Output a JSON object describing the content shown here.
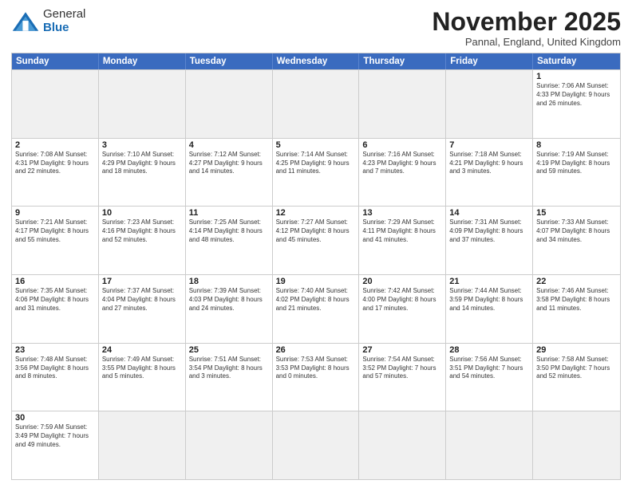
{
  "header": {
    "logo_general": "General",
    "logo_blue": "Blue",
    "title": "November 2025",
    "subtitle": "Pannal, England, United Kingdom"
  },
  "days_of_week": [
    "Sunday",
    "Monday",
    "Tuesday",
    "Wednesday",
    "Thursday",
    "Friday",
    "Saturday"
  ],
  "weeks": [
    [
      {
        "day": "",
        "info": ""
      },
      {
        "day": "",
        "info": ""
      },
      {
        "day": "",
        "info": ""
      },
      {
        "day": "",
        "info": ""
      },
      {
        "day": "",
        "info": ""
      },
      {
        "day": "",
        "info": ""
      },
      {
        "day": "1",
        "info": "Sunrise: 7:06 AM\nSunset: 4:33 PM\nDaylight: 9 hours\nand 26 minutes."
      }
    ],
    [
      {
        "day": "2",
        "info": "Sunrise: 7:08 AM\nSunset: 4:31 PM\nDaylight: 9 hours\nand 22 minutes."
      },
      {
        "day": "3",
        "info": "Sunrise: 7:10 AM\nSunset: 4:29 PM\nDaylight: 9 hours\nand 18 minutes."
      },
      {
        "day": "4",
        "info": "Sunrise: 7:12 AM\nSunset: 4:27 PM\nDaylight: 9 hours\nand 14 minutes."
      },
      {
        "day": "5",
        "info": "Sunrise: 7:14 AM\nSunset: 4:25 PM\nDaylight: 9 hours\nand 11 minutes."
      },
      {
        "day": "6",
        "info": "Sunrise: 7:16 AM\nSunset: 4:23 PM\nDaylight: 9 hours\nand 7 minutes."
      },
      {
        "day": "7",
        "info": "Sunrise: 7:18 AM\nSunset: 4:21 PM\nDaylight: 9 hours\nand 3 minutes."
      },
      {
        "day": "8",
        "info": "Sunrise: 7:19 AM\nSunset: 4:19 PM\nDaylight: 8 hours\nand 59 minutes."
      }
    ],
    [
      {
        "day": "9",
        "info": "Sunrise: 7:21 AM\nSunset: 4:17 PM\nDaylight: 8 hours\nand 55 minutes."
      },
      {
        "day": "10",
        "info": "Sunrise: 7:23 AM\nSunset: 4:16 PM\nDaylight: 8 hours\nand 52 minutes."
      },
      {
        "day": "11",
        "info": "Sunrise: 7:25 AM\nSunset: 4:14 PM\nDaylight: 8 hours\nand 48 minutes."
      },
      {
        "day": "12",
        "info": "Sunrise: 7:27 AM\nSunset: 4:12 PM\nDaylight: 8 hours\nand 45 minutes."
      },
      {
        "day": "13",
        "info": "Sunrise: 7:29 AM\nSunset: 4:11 PM\nDaylight: 8 hours\nand 41 minutes."
      },
      {
        "day": "14",
        "info": "Sunrise: 7:31 AM\nSunset: 4:09 PM\nDaylight: 8 hours\nand 37 minutes."
      },
      {
        "day": "15",
        "info": "Sunrise: 7:33 AM\nSunset: 4:07 PM\nDaylight: 8 hours\nand 34 minutes."
      }
    ],
    [
      {
        "day": "16",
        "info": "Sunrise: 7:35 AM\nSunset: 4:06 PM\nDaylight: 8 hours\nand 31 minutes."
      },
      {
        "day": "17",
        "info": "Sunrise: 7:37 AM\nSunset: 4:04 PM\nDaylight: 8 hours\nand 27 minutes."
      },
      {
        "day": "18",
        "info": "Sunrise: 7:39 AM\nSunset: 4:03 PM\nDaylight: 8 hours\nand 24 minutes."
      },
      {
        "day": "19",
        "info": "Sunrise: 7:40 AM\nSunset: 4:02 PM\nDaylight: 8 hours\nand 21 minutes."
      },
      {
        "day": "20",
        "info": "Sunrise: 7:42 AM\nSunset: 4:00 PM\nDaylight: 8 hours\nand 17 minutes."
      },
      {
        "day": "21",
        "info": "Sunrise: 7:44 AM\nSunset: 3:59 PM\nDaylight: 8 hours\nand 14 minutes."
      },
      {
        "day": "22",
        "info": "Sunrise: 7:46 AM\nSunset: 3:58 PM\nDaylight: 8 hours\nand 11 minutes."
      }
    ],
    [
      {
        "day": "23",
        "info": "Sunrise: 7:48 AM\nSunset: 3:56 PM\nDaylight: 8 hours\nand 8 minutes."
      },
      {
        "day": "24",
        "info": "Sunrise: 7:49 AM\nSunset: 3:55 PM\nDaylight: 8 hours\nand 5 minutes."
      },
      {
        "day": "25",
        "info": "Sunrise: 7:51 AM\nSunset: 3:54 PM\nDaylight: 8 hours\nand 3 minutes."
      },
      {
        "day": "26",
        "info": "Sunrise: 7:53 AM\nSunset: 3:53 PM\nDaylight: 8 hours\nand 0 minutes."
      },
      {
        "day": "27",
        "info": "Sunrise: 7:54 AM\nSunset: 3:52 PM\nDaylight: 7 hours\nand 57 minutes."
      },
      {
        "day": "28",
        "info": "Sunrise: 7:56 AM\nSunset: 3:51 PM\nDaylight: 7 hours\nand 54 minutes."
      },
      {
        "day": "29",
        "info": "Sunrise: 7:58 AM\nSunset: 3:50 PM\nDaylight: 7 hours\nand 52 minutes."
      }
    ],
    [
      {
        "day": "30",
        "info": "Sunrise: 7:59 AM\nSunset: 3:49 PM\nDaylight: 7 hours\nand 49 minutes."
      },
      {
        "day": "",
        "info": ""
      },
      {
        "day": "",
        "info": ""
      },
      {
        "day": "",
        "info": ""
      },
      {
        "day": "",
        "info": ""
      },
      {
        "day": "",
        "info": ""
      },
      {
        "day": "",
        "info": ""
      }
    ]
  ]
}
